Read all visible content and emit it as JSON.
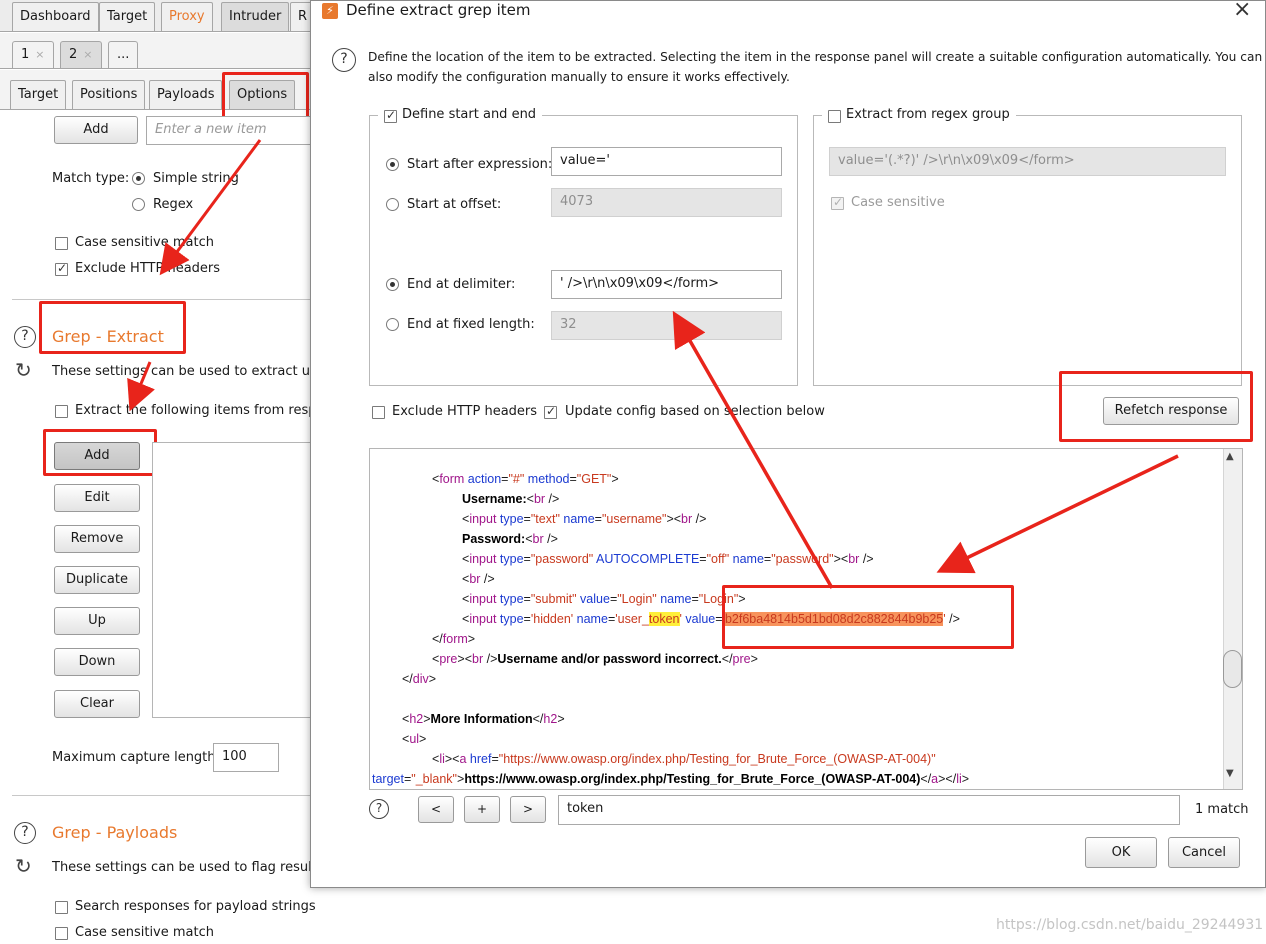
{
  "main_tabs": [
    "Dashboard",
    "Target",
    "Proxy",
    "Intruder",
    "R"
  ],
  "attack_tabs": [
    {
      "label": "1",
      "close": "×"
    },
    {
      "label": "2",
      "close": "×"
    },
    {
      "label": "..."
    }
  ],
  "sub_tabs": [
    "Target",
    "Positions",
    "Payloads",
    "Options"
  ],
  "grep_match": {
    "add_label": "Add",
    "new_item_placeholder": "Enter a new item",
    "match_type_label": "Match type:",
    "match_simple": "Simple string",
    "match_regex": "Regex",
    "case_sensitive": "Case sensitive match",
    "exclude_headers": "Exclude HTTP headers"
  },
  "grep_extract": {
    "title": "Grep - Extract",
    "desc": "These settings can be used to extract usef",
    "extract_label": "Extract the following items from respon",
    "buttons": [
      "Add",
      "Edit",
      "Remove",
      "Duplicate",
      "Up",
      "Down",
      "Clear"
    ],
    "max_capture_label": "Maximum capture length:",
    "max_capture_value": "100"
  },
  "grep_payloads": {
    "title": "Grep - Payloads",
    "desc": "These settings can be used to flag result it",
    "search_label": "Search responses for payload strings",
    "case_label": "Case sensitive match"
  },
  "dialog": {
    "title": "Define extract grep item",
    "close": "×",
    "help_line1": "Define the location of the item to be extracted. Selecting the item in the response panel will create a suitable configuration automatically. You can",
    "help_line2": "also modify the configuration manually to ensure it works effectively.",
    "define_start_end": "Define start and end",
    "start_after_label": "Start after expression:",
    "start_after_value": "value='",
    "start_offset_label": "Start at offset:",
    "start_offset_value": "4073",
    "end_delim_label": "End at delimiter:",
    "end_delim_value": "' />\\r\\n\\x09\\x09</form>",
    "end_fixed_label": "End at fixed length:",
    "end_fixed_value": "32",
    "regex_group_label": "Extract from regex group",
    "regex_value": "value='(.*?)' />\\r\\n\\x09\\x09</form>",
    "regex_case_label": "Case sensitive",
    "exclude_headers": "Exclude HTTP headers",
    "update_config": "Update config based on selection below",
    "refetch": "Refetch response",
    "search_value": "token",
    "match_count": "1 match",
    "prev": "<",
    "plus": "+",
    "next": ">",
    "ok": "OK",
    "cancel": "Cancel"
  },
  "code": {
    "form": "form",
    "action": "action",
    "hash": "\"#\"",
    "method": "method",
    "get": "\"GET\"",
    "username": "Username:",
    "br": "br",
    "input": "input",
    "type": "type",
    "text": "\"text\"",
    "name": "name",
    "username_q": "\"username\"",
    "password": "Password:",
    "password_q": "\"password\"",
    "autocomplete": "AUTOCOMPLETE",
    "off": "\"off\"",
    "submit": "\"submit\"",
    "value": "value",
    "login_q": "\"Login\"",
    "hidden": "'hidden'",
    "user_": "'user_",
    "token": "token",
    "q": "'",
    "token_value": "b2f6ba4814b5d1bd08d2c882844b9b25",
    "pre": "pre",
    "incorrect": "Username and/or password incorrect.",
    "div": "div",
    "h2": "h2",
    "more_info": "More Information",
    "ul": "ul",
    "li": "li",
    "a": "a",
    "href": "href",
    "owasp_url_q": "\"https://www.owasp.org/index.php/Testing_for_Brute_Force_(OWASP-AT-004)\"",
    "target": "target",
    "blank": "\"_blank\"",
    "owasp_url": "https://www.owasp.org/index.php/Testing_for_Brute_Force_(OWASP-AT-004)"
  },
  "watermark": "https://blog.csdn.net/baidu_29244931"
}
